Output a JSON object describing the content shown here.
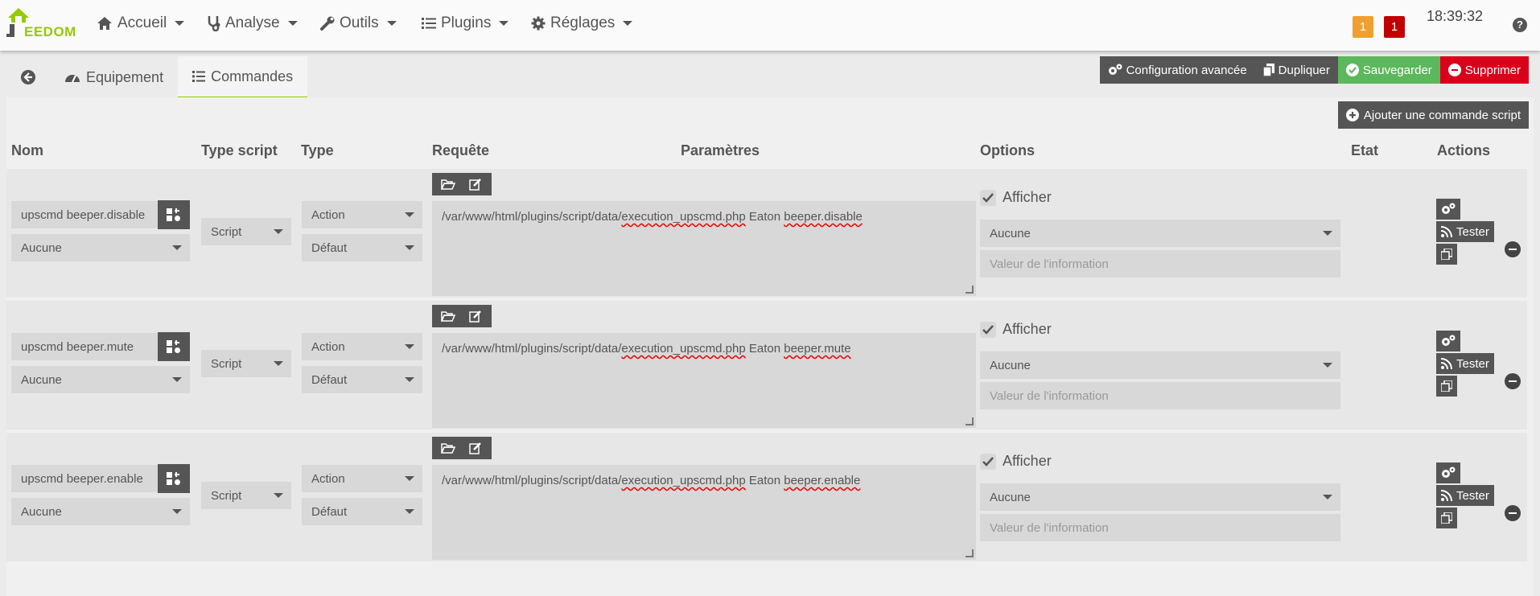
{
  "navbar": {
    "logo_text": "EEDOM",
    "menu": [
      {
        "label": "Accueil",
        "icon": "home-icon"
      },
      {
        "label": "Analyse",
        "icon": "stethoscope-icon"
      },
      {
        "label": "Outils",
        "icon": "wrench-icon"
      },
      {
        "label": "Plugins",
        "icon": "list-icon"
      },
      {
        "label": "Réglages",
        "icon": "gear-icon"
      }
    ],
    "badges": [
      {
        "value": "1",
        "color": "#f0a030"
      },
      {
        "value": "1",
        "color": "#c00000"
      }
    ],
    "clock": "18:39:32",
    "help": "?"
  },
  "tabs": {
    "back_icon": "arrow-left-circle-icon",
    "equipment": "Equipement",
    "commands": "Commandes"
  },
  "toolbar": {
    "config": "Configuration avancée",
    "duplicate": "Dupliquer",
    "save": "Sauvegarder",
    "delete": "Supprimer",
    "colors": {
      "config": "#555555",
      "duplicate": "#555555",
      "save": "#5cb85c",
      "delete": "#d9001b"
    }
  },
  "add_command": "Ajouter une commande script",
  "table": {
    "headers": {
      "name": "Nom",
      "script_type": "Type script",
      "type": "Type",
      "request": "Requête",
      "params": "Paramètres",
      "options": "Options",
      "state": "Etat",
      "actions": "Actions"
    },
    "rows": [
      {
        "name": "upscmd beeper.disable",
        "icon_select": "Aucune",
        "script_type": "Script",
        "type": "Action",
        "subtype": "Défaut",
        "req_prefix": "/var/www/html/plugins/script/data/",
        "req_file": "execution_upscmd.php",
        "req_mid": " Eaton ",
        "req_arg": "beeper.disable",
        "show_label": "Afficher",
        "option_select": "Aucune",
        "info_placeholder": "Valeur de l'information",
        "test_label": "Tester"
      },
      {
        "name": "upscmd beeper.mute",
        "icon_select": "Aucune",
        "script_type": "Script",
        "type": "Action",
        "subtype": "Défaut",
        "req_prefix": "/var/www/html/plugins/script/data/",
        "req_file": "execution_upscmd.php",
        "req_mid": " Eaton ",
        "req_arg": "beeper.mute",
        "show_label": "Afficher",
        "option_select": "Aucune",
        "info_placeholder": "Valeur de l'information",
        "test_label": "Tester"
      },
      {
        "name": "upscmd beeper.enable",
        "icon_select": "Aucune",
        "script_type": "Script",
        "type": "Action",
        "subtype": "Défaut",
        "req_prefix": "/var/www/html/plugins/script/data/",
        "req_file": "execution_upscmd.php",
        "req_mid": " Eaton ",
        "req_arg": "beeper.enable",
        "show_label": "Afficher",
        "option_select": "Aucune",
        "info_placeholder": "Valeur de l'information",
        "test_label": "Tester"
      }
    ]
  }
}
